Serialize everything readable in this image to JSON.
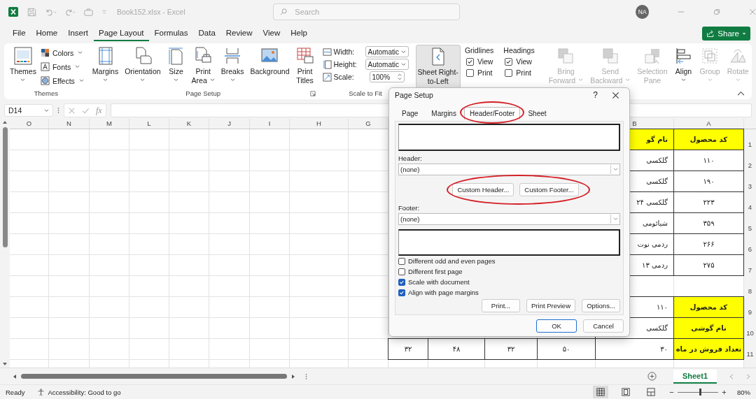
{
  "title_bar": {
    "file_name": "Book152.xlsx  -  Excel",
    "search_placeholder": "Search",
    "user_initials": "NA"
  },
  "menu_tabs": [
    {
      "label": "File",
      "selected": false
    },
    {
      "label": "Home",
      "selected": false
    },
    {
      "label": "Insert",
      "selected": false
    },
    {
      "label": "Page Layout",
      "selected": true
    },
    {
      "label": "Formulas",
      "selected": false
    },
    {
      "label": "Data",
      "selected": false
    },
    {
      "label": "Review",
      "selected": false
    },
    {
      "label": "View",
      "selected": false
    },
    {
      "label": "Help",
      "selected": false
    }
  ],
  "share_button": {
    "label": "Share"
  },
  "ribbon": {
    "themes": {
      "title": "Themes",
      "main": {
        "label": "Themes"
      },
      "options": [
        {
          "label": "Colors"
        },
        {
          "label": "Fonts"
        },
        {
          "label": "Effects"
        }
      ]
    },
    "page_setup": {
      "title": "Page Setup",
      "buttons": [
        {
          "lines": [
            "Margins"
          ],
          "dropdown": true
        },
        {
          "lines": [
            "Orientation"
          ],
          "dropdown": true
        },
        {
          "lines": [
            "Size"
          ],
          "dropdown": true
        },
        {
          "lines": [
            "Print",
            "Area"
          ],
          "dropdown": true
        },
        {
          "lines": [
            "Breaks"
          ],
          "dropdown": true
        },
        {
          "lines": [
            "Background"
          ],
          "dropdown": false
        },
        {
          "lines": [
            "Print",
            "Titles"
          ],
          "dropdown": false
        }
      ]
    },
    "scale_to_fit": {
      "title": "Scale to Fit",
      "fields": [
        {
          "kind": "dropdown",
          "label": "Width:",
          "value": "Automatic"
        },
        {
          "kind": "dropdown",
          "label": "Height:",
          "value": "Automatic"
        },
        {
          "kind": "spinner",
          "label": "Scale:",
          "value": "100%"
        }
      ]
    },
    "sheet_options": {
      "rtl_button": {
        "lines": [
          "Sheet Right-",
          "to-Left"
        ],
        "selected": true
      },
      "columns": [
        {
          "title": "Gridlines",
          "options": [
            {
              "label": "View",
              "checked": true
            },
            {
              "label": "Print",
              "checked": false
            }
          ]
        },
        {
          "title": "Headings",
          "options": [
            {
              "label": "View",
              "checked": true
            },
            {
              "label": "Print",
              "checked": false
            }
          ]
        }
      ]
    },
    "arrange": {
      "buttons": [
        {
          "lines": [
            "Bring",
            "Forward"
          ],
          "dropdown": true,
          "disabled": true
        },
        {
          "lines": [
            "Send",
            "Backward"
          ],
          "dropdown": true,
          "disabled": true
        },
        {
          "lines": [
            "Selection",
            "Pane"
          ],
          "dropdown": false,
          "disabled": true
        },
        {
          "lines": [
            "Align"
          ],
          "dropdown": true,
          "disabled": false
        },
        {
          "lines": [
            "Group"
          ],
          "dropdown": true,
          "disabled": true
        },
        {
          "lines": [
            "Rotate"
          ],
          "dropdown": true,
          "disabled": true
        }
      ]
    }
  },
  "formula_bar": {
    "name_box": "D14",
    "function_label": "fx"
  },
  "sheet": {
    "column_headers_left": [
      "O",
      "N",
      "M",
      "L",
      "K",
      "J",
      "I",
      "H",
      "G"
    ],
    "column_headers_right": [
      "B",
      "A"
    ],
    "rows": [
      {
        "header": "1",
        "cells": [
          {
            "text": "نام گو",
            "highlighted": true
          },
          {
            "text": "كد محصول",
            "highlighted": true
          }
        ]
      },
      {
        "header": "2",
        "cells": [
          {
            "text": "گلکسی",
            "highlighted": false
          },
          {
            "text": "۱۱۰",
            "highlighted": false
          }
        ]
      },
      {
        "header": "3",
        "cells": [
          {
            "text": "گلکسی",
            "highlighted": false
          },
          {
            "text": "۱۹۰",
            "highlighted": false
          }
        ]
      },
      {
        "header": "4",
        "cells": [
          {
            "text": "گلکسی ۲۴",
            "highlighted": false
          },
          {
            "text": "۲۲۳",
            "highlighted": false
          }
        ]
      },
      {
        "header": "5",
        "cells": [
          {
            "text": "شیائومی",
            "highlighted": false
          },
          {
            "text": "۳۵۹",
            "highlighted": false
          }
        ]
      },
      {
        "header": "6",
        "cells": [
          {
            "text": "ردمی نوت",
            "highlighted": false
          },
          {
            "text": "۲۶۶",
            "highlighted": false
          }
        ]
      },
      {
        "header": "7",
        "cells": [
          {
            "text": "ردمی ۱۳",
            "highlighted": false
          },
          {
            "text": "۲۷۵",
            "highlighted": false
          }
        ]
      },
      {
        "header": "8",
        "cells": []
      },
      {
        "header": "9",
        "cells": [
          {
            "text": "۱۱۰",
            "highlighted": false
          },
          {
            "text": "كد محصول",
            "highlighted": true
          }
        ]
      },
      {
        "header": "10",
        "cells": [
          {
            "text": "گلکسی",
            "highlighted": false
          },
          {
            "text": "نام گوشی",
            "highlighted": true
          }
        ]
      },
      {
        "header": "11",
        "cells": [
          {
            "text": "۳۲",
            "highlighted": false
          },
          {
            "text": "۴۸",
            "highlighted": false
          },
          {
            "text": "۳۲",
            "highlighted": false
          },
          {
            "text": "۵۰",
            "highlighted": false
          },
          {
            "text": "۳۰",
            "highlighted": false
          },
          {
            "text": "تعداد فروش در ماه",
            "highlighted": true
          }
        ]
      }
    ],
    "tabs": [
      {
        "label": "Sheet1",
        "selected": true
      }
    ]
  },
  "status_bar": {
    "ready": "Ready",
    "accessibility": "Accessibility: Good to go",
    "views": [
      {
        "selected": true
      },
      {
        "selected": false
      },
      {
        "selected": false
      }
    ],
    "zoom": {
      "level": 0.55,
      "reading": "80%"
    }
  },
  "dialog": {
    "title": "Page Setup",
    "help": "?",
    "tabs": [
      {
        "label": "Page",
        "selected": false,
        "circled": false
      },
      {
        "label": "Margins",
        "selected": false,
        "circled": false
      },
      {
        "label": "Header/Footer",
        "selected": true,
        "circled": true
      },
      {
        "label": "Sheet",
        "selected": false,
        "circled": false
      }
    ],
    "header": {
      "label": "Header:",
      "value": "(none)"
    },
    "custom_buttons": {
      "circled": true,
      "buttons": [
        {
          "label": "Custom Header..."
        },
        {
          "label": "Custom Footer..."
        }
      ]
    },
    "footer": {
      "label": "Footer:",
      "value": "(none)"
    },
    "options": [
      {
        "label": "Different odd and even pages",
        "checked": false
      },
      {
        "label": "Different first page",
        "checked": false
      },
      {
        "label": "Scale with document",
        "checked": true
      },
      {
        "label": "Align with page margins",
        "checked": true
      }
    ],
    "action_buttons": [
      {
        "label": "Print..."
      },
      {
        "label": "Print Preview"
      },
      {
        "label": "Options..."
      }
    ],
    "footer_buttons": [
      {
        "label": "OK",
        "default": true
      },
      {
        "label": "Cancel",
        "default": false
      }
    ]
  }
}
